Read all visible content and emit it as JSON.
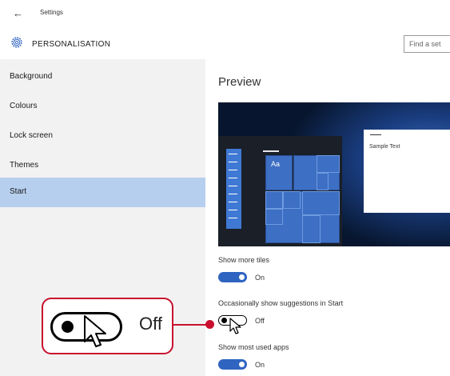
{
  "window": {
    "back_glyph": "←",
    "title": "Settings"
  },
  "header": {
    "title": "PERSONALISATION",
    "search_placeholder": "Find a set"
  },
  "sidebar": {
    "items": [
      {
        "label": "Background"
      },
      {
        "label": "Colours"
      },
      {
        "label": "Lock screen"
      },
      {
        "label": "Themes"
      },
      {
        "label": "Start",
        "selected": true
      }
    ]
  },
  "main": {
    "preview_title": "Preview",
    "preview": {
      "tile_label": "Aa",
      "sample_text": "Sample Text"
    },
    "settings": [
      {
        "label": "Show more tiles",
        "state": "On"
      },
      {
        "label": "Occasionally show suggestions in Start",
        "state": "Off"
      },
      {
        "label": "Show most used apps",
        "state": "On"
      }
    ]
  },
  "callout": {
    "state": "Off"
  },
  "icons": {
    "gear": "gear-icon",
    "back": "back-arrow-icon",
    "cursor": "mouse-pointer-icon"
  },
  "colors": {
    "accent": "#2f64c1",
    "selection": "#b7cfee",
    "callout_border": "#c8102e",
    "sidebar": "#f2f2f2"
  }
}
